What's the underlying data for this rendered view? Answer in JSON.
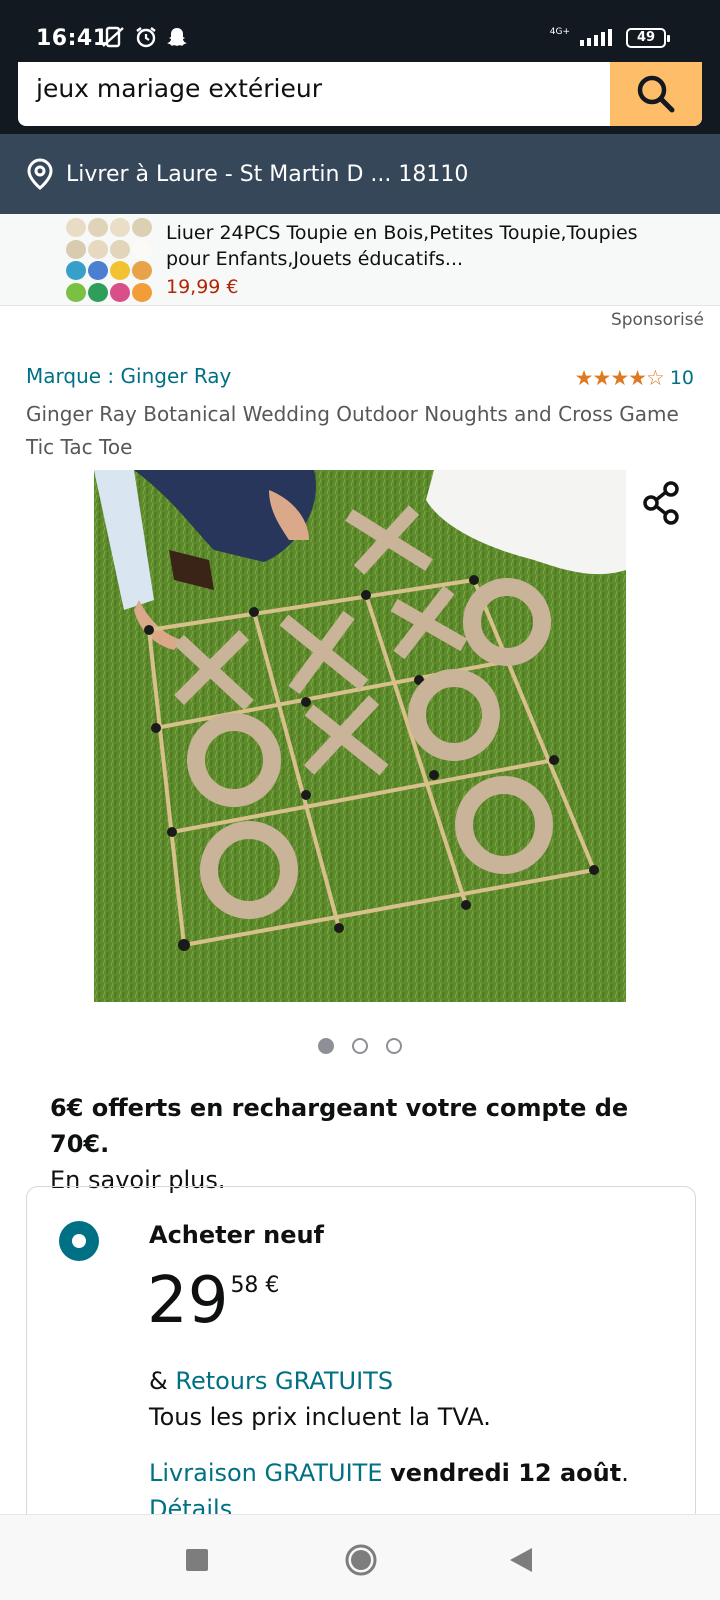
{
  "status_bar": {
    "time": "16:41",
    "network": "4G+",
    "battery": "49"
  },
  "search": {
    "query": "jeux mariage extérieur"
  },
  "delivery": {
    "text": "Livrer à Laure - St Martin D ... 18110"
  },
  "sponsored_product": {
    "title": "Liuer 24PCS Toupie en Bois,Petites Toupie,Toupies pour Enfants,Jouets éducatifs...",
    "price": "19,99 €"
  },
  "sponsored_label": "Sponsorisé",
  "product": {
    "brand": "Marque : Ginger Ray",
    "stars": "★★★★☆",
    "rating_count": "10",
    "title": "Ginger Ray Botanical Wedding Outdoor Noughts and Cross Game Tic Tac Toe",
    "image_index": 1,
    "image_count": 3
  },
  "promo": {
    "bold": "6€ offerts en rechargeant votre compte de 70€.",
    "link": "En savoir plus."
  },
  "buybox": {
    "title": "Acheter neuf",
    "price_whole": "29",
    "price_fraction": "58 €",
    "returns_prefix": "& ",
    "returns_link": "Retours GRATUITS",
    "tva": "Tous les prix incluent la TVA.",
    "delivery_link": "Livraison GRATUITE",
    "delivery_date": "vendredi 12 août",
    "delivery_suffix": ".",
    "details": "Détails"
  },
  "colors": {
    "header": "#131921",
    "delivery_bar": "#37475a",
    "search_button": "#febd69",
    "link": "#007185",
    "price_red": "#b12704",
    "star": "#de7921"
  }
}
